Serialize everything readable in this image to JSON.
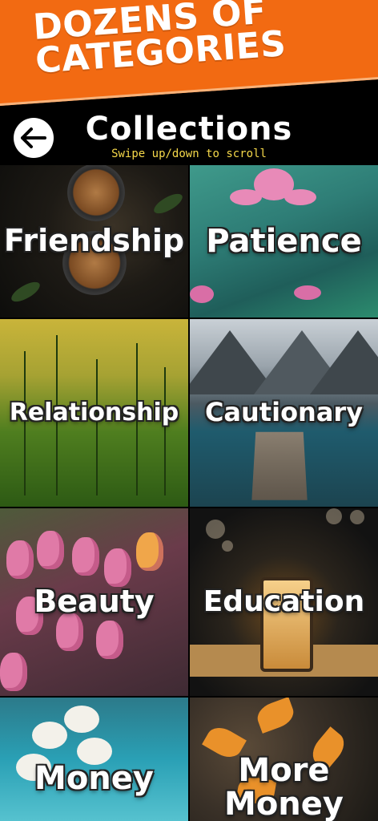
{
  "promo": {
    "line1": "DOZENS OF",
    "line2": "CATEGORIES",
    "band_color": "#f26a12"
  },
  "header": {
    "back_icon": "arrow-left-icon",
    "title": "Collections",
    "subtitle": "Swipe up/down to scroll",
    "subtitle_color": "#f5d84a"
  },
  "categories": [
    {
      "label": "Friendship"
    },
    {
      "label": "Patience"
    },
    {
      "label": "Relationship"
    },
    {
      "label": "Cautionary"
    },
    {
      "label": "Beauty"
    },
    {
      "label": "Education"
    },
    {
      "label": "Money"
    },
    {
      "label": "More Money"
    }
  ]
}
